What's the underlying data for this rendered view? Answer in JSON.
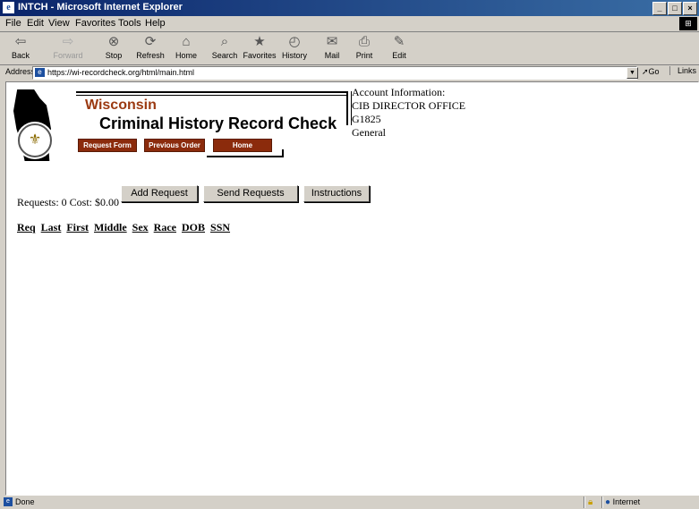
{
  "window": {
    "title": "INTCH - Microsoft Internet Explorer"
  },
  "menu": [
    "File",
    "Edit",
    "View",
    "Favorites",
    "Tools",
    "Help"
  ],
  "toolbar": {
    "back": "Back",
    "forward": "Forward",
    "stop": "Stop",
    "refresh": "Refresh",
    "home": "Home",
    "search": "Search",
    "favorites": "Favorites",
    "history": "History",
    "mail": "Mail",
    "print": "Print",
    "edit": "Edit"
  },
  "address": {
    "label": "Address",
    "url": "https://wi-recordcheck.org/html/main.html",
    "go": "Go",
    "links": "Links"
  },
  "page": {
    "state": "Wisconsin",
    "title": "Criminal History Record Check",
    "nav": {
      "request_form": "Request Form",
      "previous_order": "Previous Order",
      "home": "Home"
    },
    "account": {
      "heading": "Account Information:",
      "office": "CIB DIRECTOR OFFICE",
      "id": "G1825",
      "type": "General"
    },
    "requests_line": "Requests: 0 Cost: $0.00",
    "buttons": {
      "add": "Add Request",
      "send": "Send Requests",
      "instructions": "Instructions"
    },
    "columns": [
      "Req",
      "Last",
      "First",
      "Middle",
      "Sex",
      "Race",
      "DOB",
      "SSN"
    ]
  },
  "status": {
    "text": "Done",
    "zone": "Internet"
  }
}
